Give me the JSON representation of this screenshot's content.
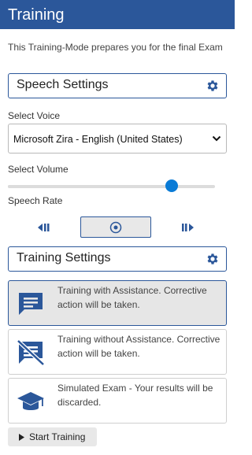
{
  "header": {
    "title": "Training"
  },
  "intro": {
    "text": "This Training-Mode prepares you for the final Exam"
  },
  "speech_settings": {
    "title": "Speech Settings"
  },
  "voice": {
    "label": "Select Voice",
    "value": "Microsoft Zira - English (United States)"
  },
  "volume": {
    "label": "Select Volume",
    "level_percent": 79
  },
  "speech_rate": {
    "label": "Speech Rate"
  },
  "training_settings": {
    "title": "Training Settings"
  },
  "modes": [
    {
      "text": "Training with Assistance. Corrective action will be taken.",
      "icon": "chat-message-icon",
      "selected": true
    },
    {
      "text": "Training without Assistance. Corrective action will be taken.",
      "icon": "chat-off-icon",
      "selected": false
    },
    {
      "text": "Simulated Exam - Your results will be discarded.",
      "icon": "graduation-cap-icon",
      "selected": false
    }
  ],
  "start": {
    "label": "Start Training"
  },
  "colors": {
    "brand": "#2b579a",
    "accent": "#0a7bd6"
  }
}
